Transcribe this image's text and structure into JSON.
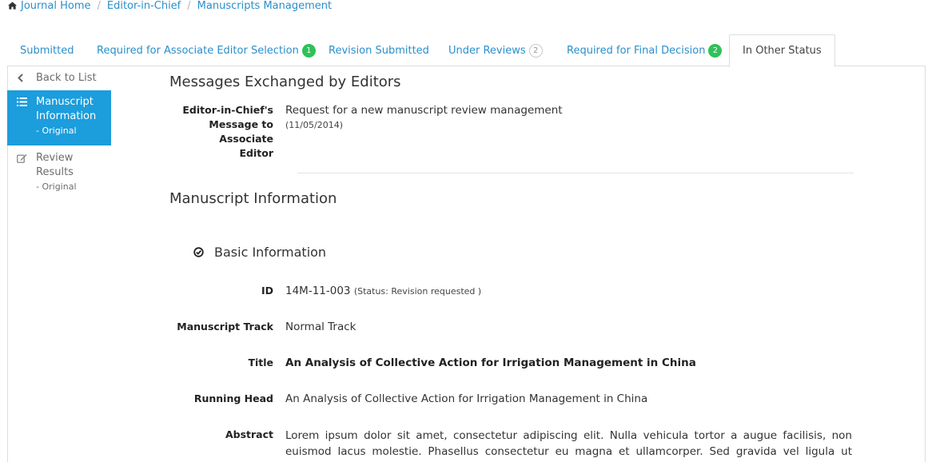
{
  "breadcrumb": {
    "items": [
      "Journal Home",
      "Editor-in-Chief",
      "Manuscripts Management"
    ]
  },
  "tabs": [
    {
      "label": "Submitted",
      "badge": null
    },
    {
      "label": "Required for Associate Editor Selection",
      "badge": "1"
    },
    {
      "label": "Revision Submitted",
      "badge": null
    },
    {
      "label": "Under Reviews",
      "badge": "2"
    },
    {
      "label": "Required for Final Decision",
      "badge": "2"
    },
    {
      "label": "In Other Status",
      "badge": null
    }
  ],
  "sidenav": {
    "back": "Back to List",
    "manuscript_info": {
      "line1": "Manuscript",
      "line2": "Information",
      "sub": "- Original"
    },
    "review_results": {
      "line1": "Review",
      "line2": "Results",
      "sub": "- Original"
    }
  },
  "messages": {
    "title": "Messages Exchanged by Editors",
    "label_line1": "Editor-in-Chief's",
    "label_line2": "Message to Associate",
    "label_line3": "Editor",
    "text": "Request for a new manuscript review management",
    "date": "(11/05/2014)"
  },
  "manuscript": {
    "title": "Manuscript Information",
    "basic_info": "Basic Information",
    "fields": {
      "id_label": "ID",
      "id_value": "14M-11-003",
      "id_status": "(Status: Revision requested )",
      "track_label": "Manuscript Track",
      "track_value": "Normal Track",
      "title_label": "Title",
      "title_value": "An Analysis of Collective Action for Irrigation Management in China",
      "head_label": "Running Head",
      "head_value": "An Analysis of Collective Action for Irrigation Management in China",
      "abstract_label": "Abstract",
      "abstract_value": "Lorem ipsum dolor sit amet, consectetur adipiscing elit. Nulla vehicula tortor a augue facilisis, non euismod lacus molestie. Phasellus consectetur eu magna et ullamcorper. Sed gravida vel ligula ut ultrices. Nulla et"
    }
  },
  "colors": {
    "link": "#2a8fcb",
    "active_nav": "#1c9ddc",
    "badge_green": "#2fc15a"
  }
}
